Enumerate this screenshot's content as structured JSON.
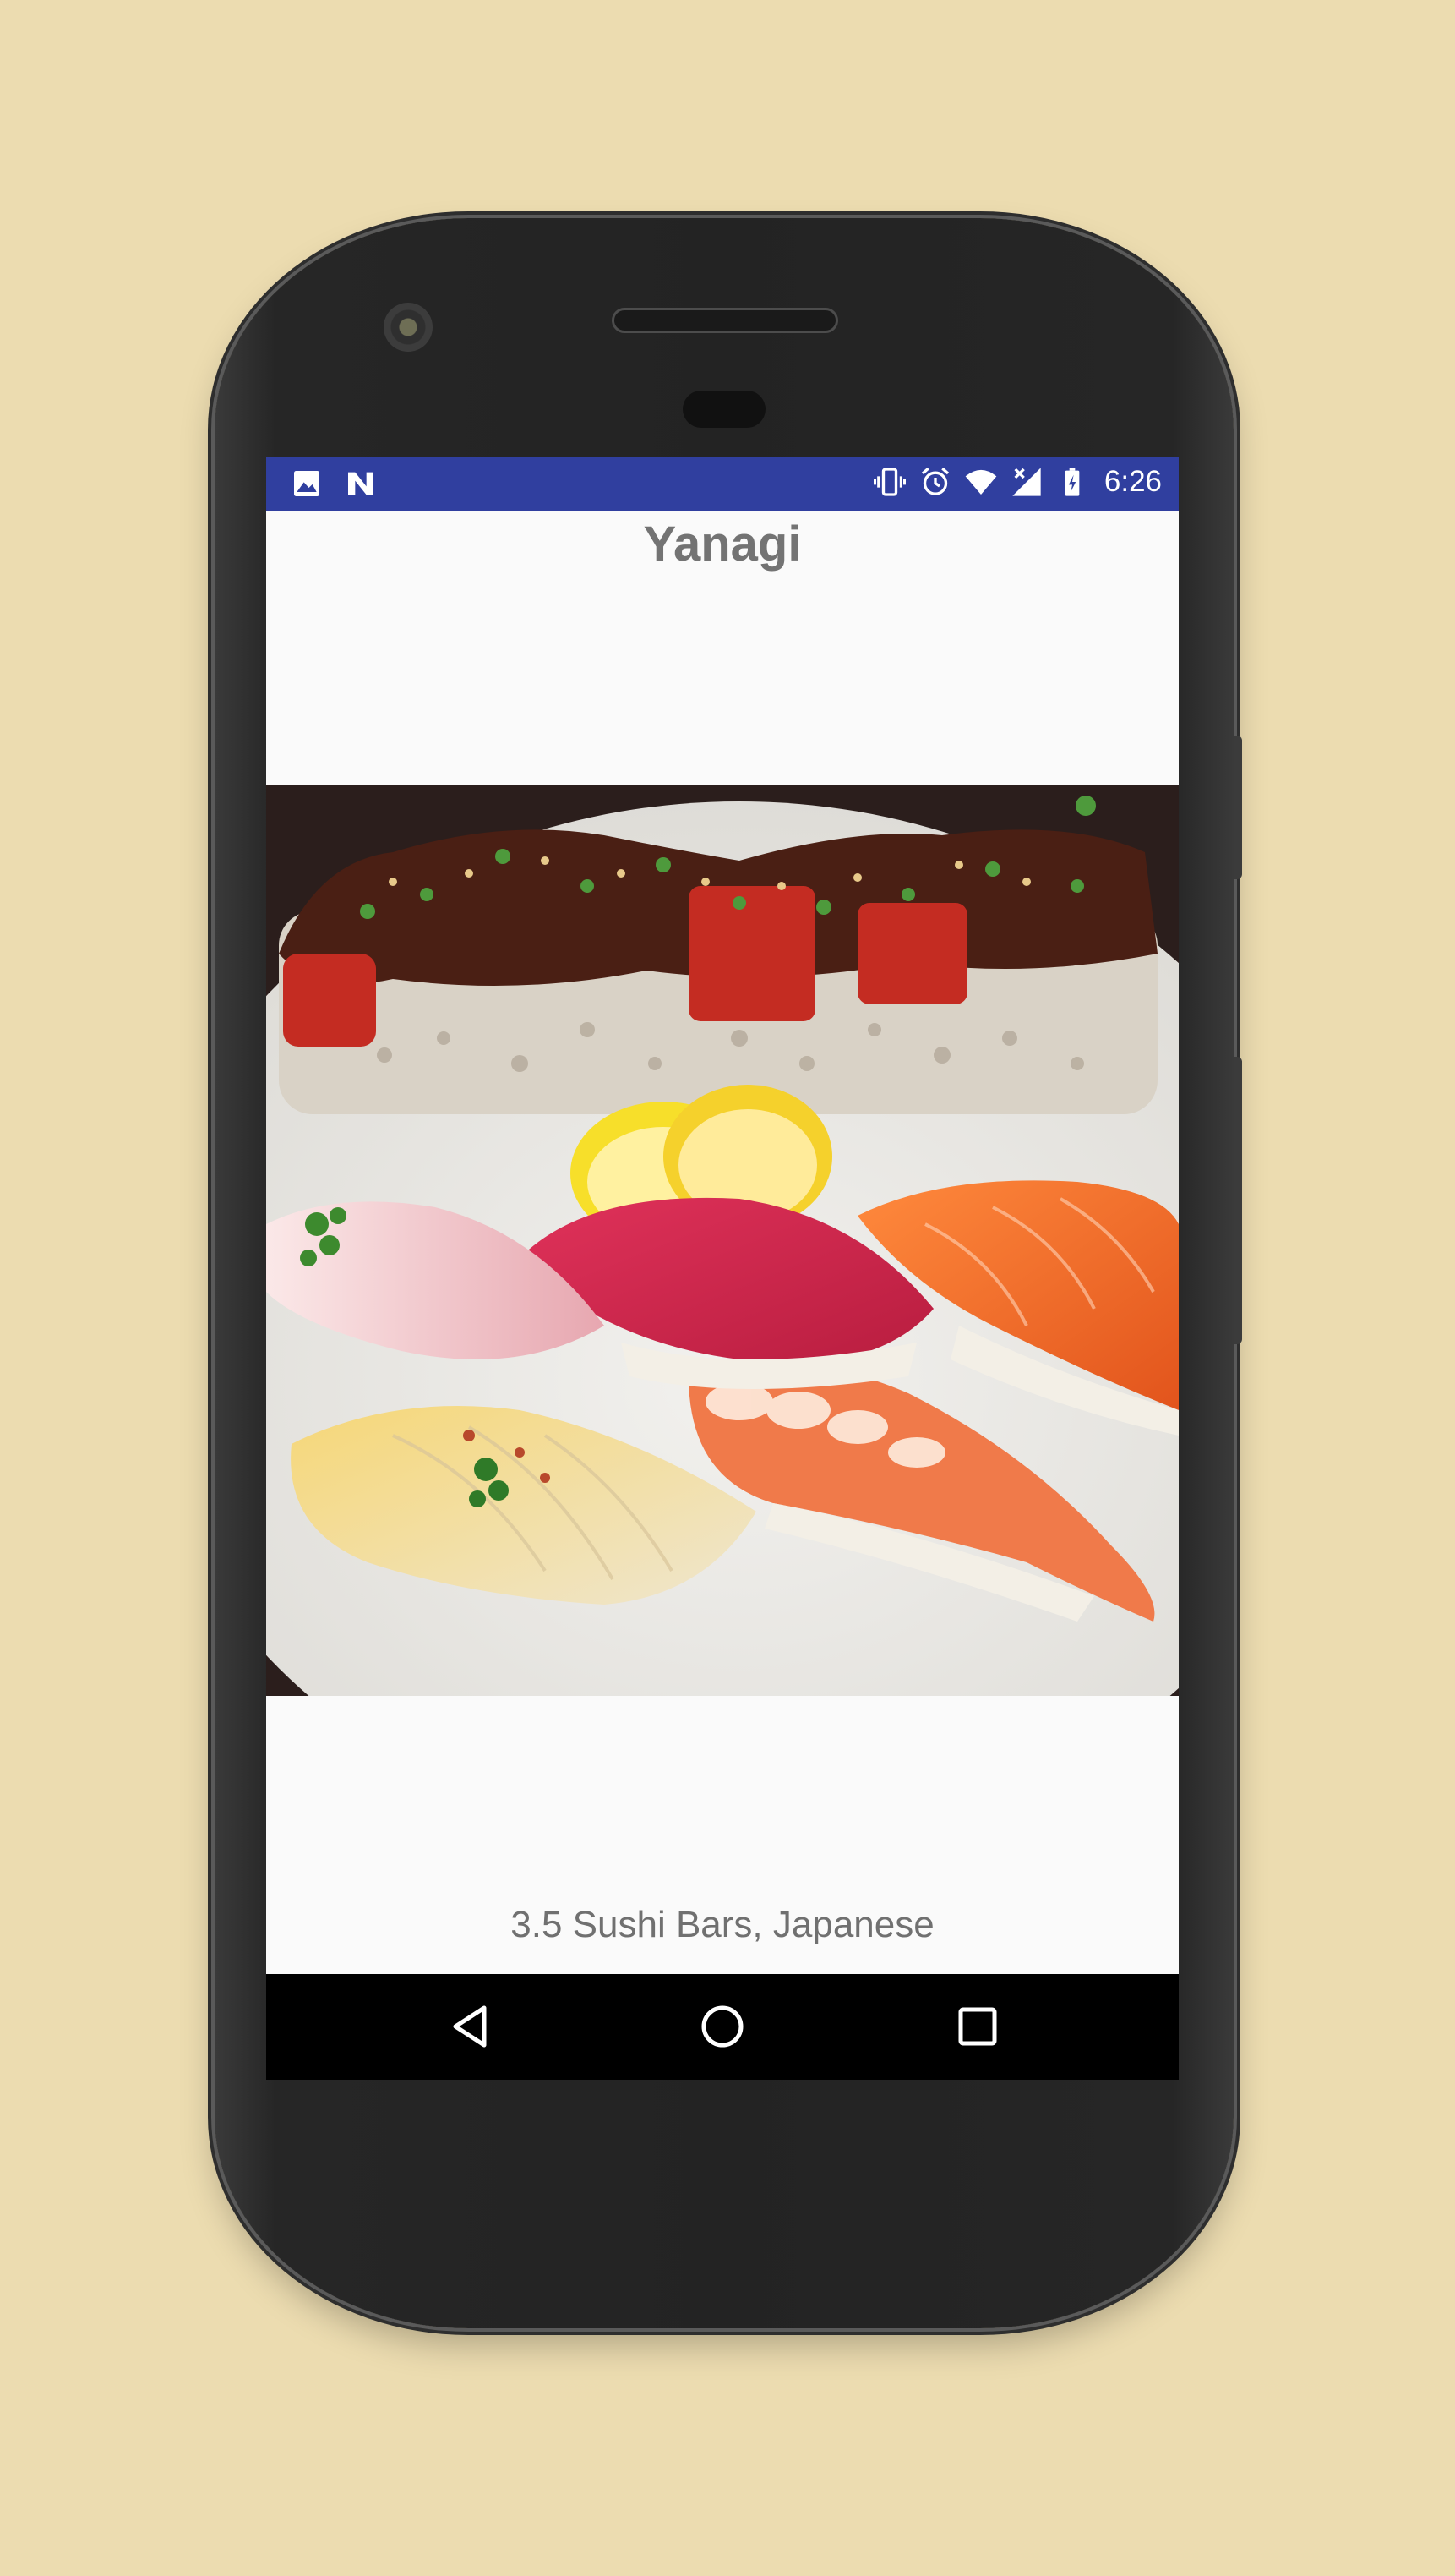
{
  "status_bar": {
    "time": "6:26",
    "left_icons": [
      "image-icon",
      "n-logo-icon"
    ],
    "right_icons": [
      "vibrate-icon",
      "alarm-icon",
      "wifi-icon",
      "signal-icon",
      "battery-charging-icon"
    ]
  },
  "detail": {
    "title": "Yanagi",
    "subtitle": "3.5 Sushi Bars, Japanese",
    "photo_icon": "sushi-photo"
  },
  "nav_bar": {
    "back_icon": "back-icon",
    "home_icon": "home-icon",
    "recents_icon": "recents-icon"
  },
  "colors": {
    "background": "#ecdcb0",
    "status_bar": "#303f9f",
    "screen": "#fafafa",
    "text": "#737373"
  }
}
